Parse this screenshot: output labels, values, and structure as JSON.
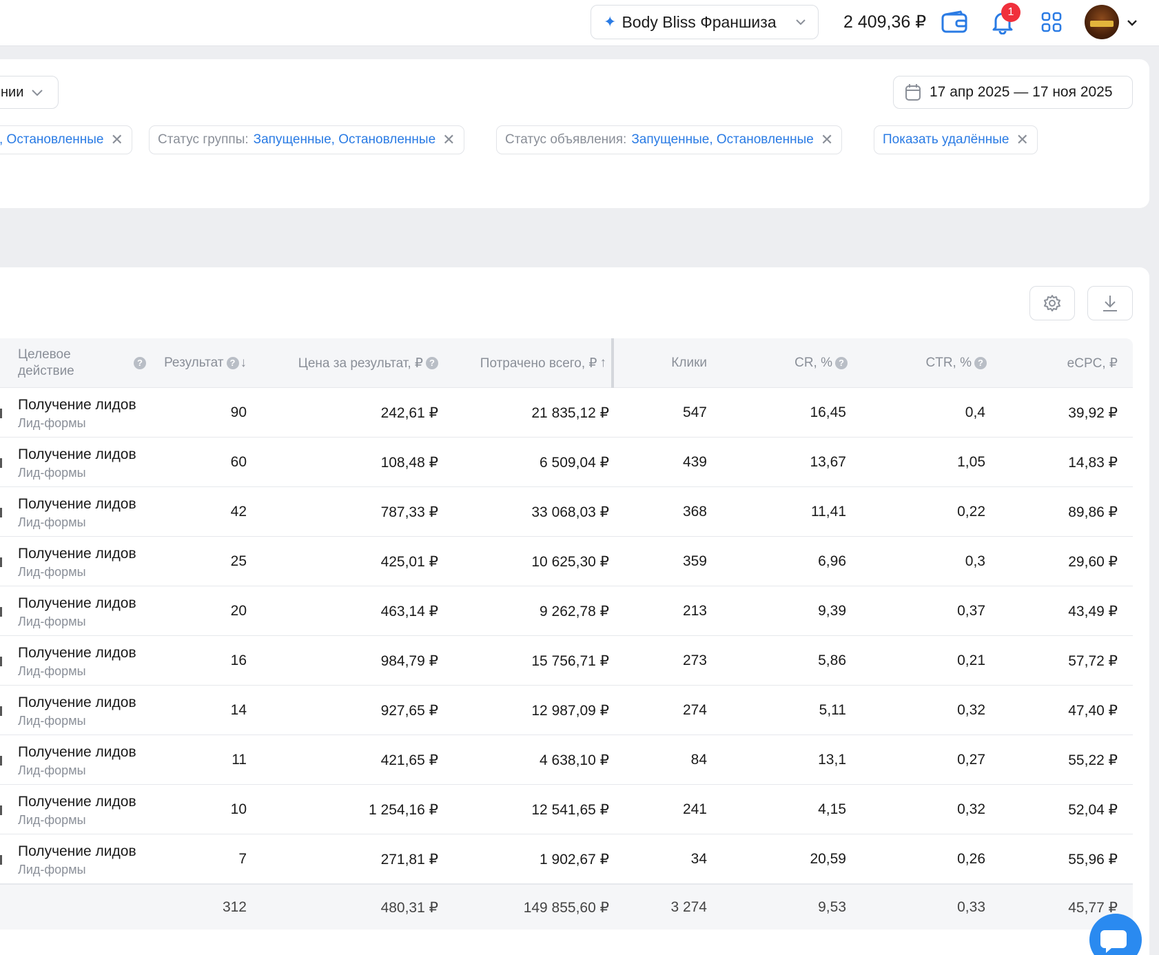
{
  "header": {
    "account_name": "Body Bliss Франшиза",
    "balance": "2 409,36 ₽",
    "notifications_count": "1"
  },
  "filters": {
    "view_select_label": "нии",
    "date_range": "17 апр 2025 — 17 ноя 2025",
    "chips": [
      {
        "key": "",
        "value": ", Остановленные"
      },
      {
        "key": "Статус группы:",
        "value": "Запущенные, Остановленные"
      },
      {
        "key": "Статус объявления:",
        "value": "Запущенные, Остановленные"
      },
      {
        "key": "",
        "value": "Показать удалённые"
      }
    ]
  },
  "table": {
    "columns": {
      "action": "Целевое действие",
      "result": "Результат",
      "cost_per_result": "Цена за результат, ₽",
      "spent": "Потрачено всего, ₽",
      "clicks": "Клики",
      "cr": "CR, %",
      "ctr": "CTR, %",
      "ecpc": "eCPC, ₽"
    },
    "rows": [
      {
        "action": "Получение лидов",
        "sub": "Лид-формы",
        "result": "90",
        "cpr": "242,61 ₽",
        "spent": "21 835,12 ₽",
        "clicks": "547",
        "cr": "16,45",
        "ctr": "0,4",
        "ecpc": "39,92 ₽"
      },
      {
        "action": "Получение лидов",
        "sub": "Лид-формы",
        "result": "60",
        "cpr": "108,48 ₽",
        "spent": "6 509,04 ₽",
        "clicks": "439",
        "cr": "13,67",
        "ctr": "1,05",
        "ecpc": "14,83 ₽"
      },
      {
        "action": "Получение лидов",
        "sub": "Лид-формы",
        "result": "42",
        "cpr": "787,33 ₽",
        "spent": "33 068,03 ₽",
        "clicks": "368",
        "cr": "11,41",
        "ctr": "0,22",
        "ecpc": "89,86 ₽"
      },
      {
        "action": "Получение лидов",
        "sub": "Лид-формы",
        "result": "25",
        "cpr": "425,01 ₽",
        "spent": "10 625,30 ₽",
        "clicks": "359",
        "cr": "6,96",
        "ctr": "0,3",
        "ecpc": "29,60 ₽"
      },
      {
        "action": "Получение лидов",
        "sub": "Лид-формы",
        "result": "20",
        "cpr": "463,14 ₽",
        "spent": "9 262,78 ₽",
        "clicks": "213",
        "cr": "9,39",
        "ctr": "0,37",
        "ecpc": "43,49 ₽"
      },
      {
        "action": "Получение лидов",
        "sub": "Лид-формы",
        "result": "16",
        "cpr": "984,79 ₽",
        "spent": "15 756,71 ₽",
        "clicks": "273",
        "cr": "5,86",
        "ctr": "0,21",
        "ecpc": "57,72 ₽"
      },
      {
        "action": "Получение лидов",
        "sub": "Лид-формы",
        "result": "14",
        "cpr": "927,65 ₽",
        "spent": "12 987,09 ₽",
        "clicks": "274",
        "cr": "5,11",
        "ctr": "0,32",
        "ecpc": "47,40 ₽"
      },
      {
        "action": "Получение лидов",
        "sub": "Лид-формы",
        "result": "11",
        "cpr": "421,65 ₽",
        "spent": "4 638,10 ₽",
        "clicks": "84",
        "cr": "13,1",
        "ctr": "0,27",
        "ecpc": "55,22 ₽"
      },
      {
        "action": "Получение лидов",
        "sub": "Лид-формы",
        "result": "10",
        "cpr": "1 254,16 ₽",
        "spent": "12 541,65 ₽",
        "clicks": "241",
        "cr": "4,15",
        "ctr": "0,32",
        "ecpc": "52,04 ₽"
      },
      {
        "action": "Получение лидов",
        "sub": "Лид-формы",
        "result": "7",
        "cpr": "271,81 ₽",
        "spent": "1 902,67 ₽",
        "clicks": "34",
        "cr": "20,59",
        "ctr": "0,26",
        "ecpc": "55,96 ₽"
      }
    ],
    "totals": {
      "result": "312",
      "cpr": "480,31 ₽",
      "spent": "149 855,60 ₽",
      "clicks": "3 274",
      "cr": "9,53",
      "ctr": "0,33",
      "ecpc": "45,77 ₽"
    }
  }
}
